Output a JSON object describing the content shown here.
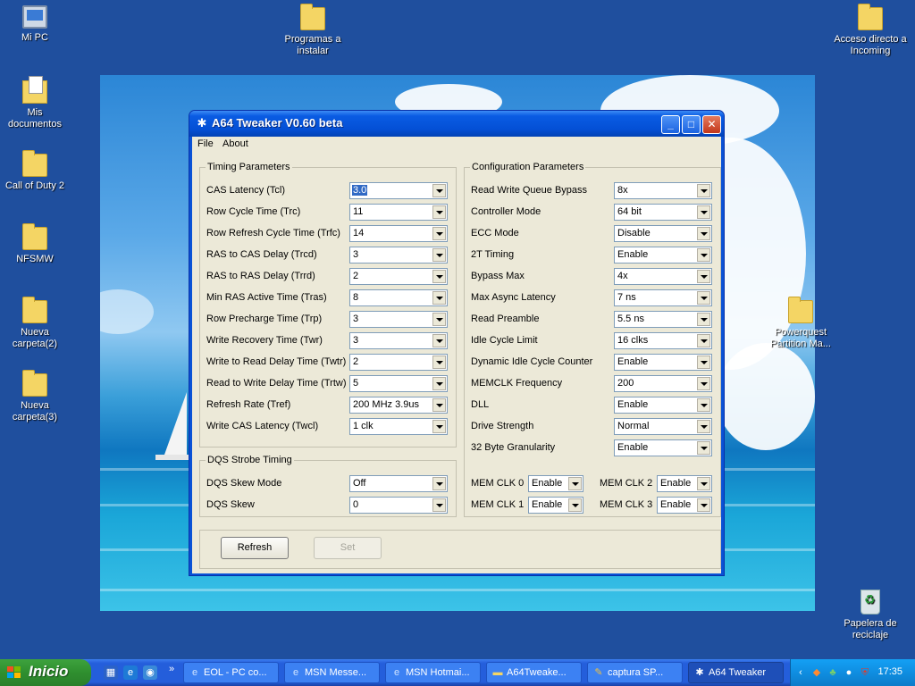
{
  "desktop": {
    "icons": [
      {
        "label": "Mi PC"
      },
      {
        "label": "Mis documentos"
      },
      {
        "label": "Call of Duty 2"
      },
      {
        "label": "NFSMW"
      },
      {
        "label": "Nueva carpeta(2)"
      },
      {
        "label": "Nueva carpeta(3)"
      },
      {
        "label": "Programas a instalar"
      },
      {
        "label": "Acceso directo a Incoming"
      },
      {
        "label": "Powerquest Partition Ma..."
      },
      {
        "label": "Papelera de reciclaje"
      }
    ]
  },
  "window": {
    "title": "A64 Tweaker V0.60 beta",
    "buttons": {
      "minimize": "_",
      "maximize": "□",
      "close": "✕"
    },
    "menu": {
      "file": "File",
      "about": "About"
    },
    "timing": {
      "title": "Timing Parameters",
      "rows": [
        {
          "label": "CAS Latency (Tcl)",
          "value": "3.0"
        },
        {
          "label": "Row Cycle Time (Trc)",
          "value": "11"
        },
        {
          "label": "Row Refresh Cycle Time (Trfc)",
          "value": "14"
        },
        {
          "label": "RAS to CAS Delay (Trcd)",
          "value": "3"
        },
        {
          "label": "RAS to RAS Delay (Trrd)",
          "value": "2"
        },
        {
          "label": "Min RAS Active Time (Tras)",
          "value": "8"
        },
        {
          "label": "Row Precharge Time (Trp)",
          "value": "3"
        },
        {
          "label": "Write Recovery Time (Twr)",
          "value": "3"
        },
        {
          "label": "Write to Read Delay Time (Twtr)",
          "value": "2"
        },
        {
          "label": "Read to Write Delay Time (Trtw)",
          "value": "5"
        },
        {
          "label": "Refresh Rate (Tref)",
          "value": "200 MHz 3.9us"
        },
        {
          "label": "Write CAS Latency (Twcl)",
          "value": "1 clk"
        }
      ]
    },
    "dqs": {
      "title": "DQS Strobe Timing",
      "rows": [
        {
          "label": "DQS Skew Mode",
          "value": "Off"
        },
        {
          "label": "DQS Skew",
          "value": "0"
        }
      ]
    },
    "config": {
      "title": "Configuration Parameters",
      "rows": [
        {
          "label": "Read Write Queue Bypass",
          "value": "8x"
        },
        {
          "label": "Controller Mode",
          "value": "64 bit"
        },
        {
          "label": "ECC Mode",
          "value": "Disable"
        },
        {
          "label": "2T Timing",
          "value": "Enable"
        },
        {
          "label": "Bypass Max",
          "value": "4x"
        },
        {
          "label": "Max Async Latency",
          "value": "7 ns"
        },
        {
          "label": "Read Preamble",
          "value": "5.5 ns"
        },
        {
          "label": "Idle Cycle Limit",
          "value": "16 clks"
        },
        {
          "label": "Dynamic Idle Cycle Counter",
          "value": "Enable"
        },
        {
          "label": "MEMCLK Frequency",
          "value": "200"
        },
        {
          "label": "DLL",
          "value": "Enable"
        },
        {
          "label": "Drive Strength",
          "value": "Normal"
        },
        {
          "label": "32 Byte Granularity",
          "value": "Enable"
        }
      ],
      "memclk": [
        {
          "label": "MEM CLK 0",
          "value": "Enable"
        },
        {
          "label": "MEM CLK 2",
          "value": "Enable"
        },
        {
          "label": "MEM CLK 1",
          "value": "Enable"
        },
        {
          "label": "MEM CLK 3",
          "value": "Enable"
        }
      ]
    },
    "actions": {
      "refresh": "Refresh",
      "set": "Set"
    }
  },
  "taskbar": {
    "start": "Inicio",
    "quicklaunch_more": "»",
    "tasks": [
      {
        "label": "EOL - PC co..."
      },
      {
        "label": "MSN Messe..."
      },
      {
        "label": "MSN Hotmai..."
      },
      {
        "label": "A64Tweake..."
      },
      {
        "label": "captura SP..."
      },
      {
        "label": "A64 Tweaker"
      }
    ],
    "clock": "17:35"
  },
  "colors": {
    "desktop": "#1f4f9e",
    "titlebar": "#0450d6",
    "dialog": "#ece9d8",
    "start": "#3ea23e",
    "tray": "#0f8ee1"
  }
}
